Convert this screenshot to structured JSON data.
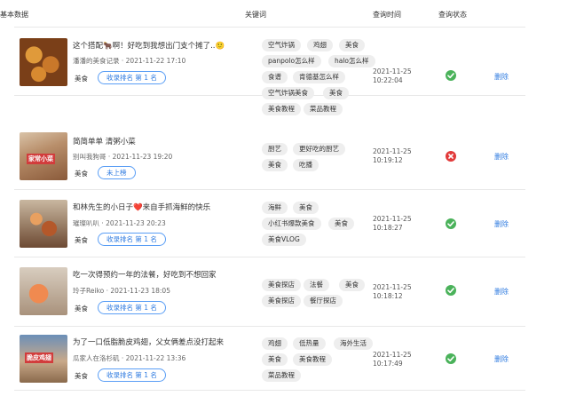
{
  "header": {
    "basic": "基本数据",
    "keywords": "关键词",
    "query_time": "查询时间",
    "query_status": "查询状态"
  },
  "rows": [
    {
      "title": "这个搭配🐂啊！好吃到我想出门支个摊了..🙂",
      "author_date": "潘潘的美食记录 · 2021-11-22 17:10",
      "category": "美食",
      "rank_label": "收录排名 第 1 名",
      "keywords": [
        "空气炸锅",
        "鸡翅",
        "美食",
        "panpolo怎么样",
        "halo怎么样",
        "食谱",
        "肯德基怎么样",
        "空气炸锅美食",
        "美食",
        "美食教程",
        "菜品教程"
      ],
      "time_date": "2021-11-25",
      "time_clock": "10:22:04",
      "status": "success",
      "delete_label": "删除"
    },
    {
      "title": "简简单单 清粥小菜",
      "author_date": "别叫我狗哥 · 2021-11-23 19:20",
      "category": "美食",
      "rank_label": "未上榜",
      "keywords": [
        "厨艺",
        "更好吃的厨艺",
        "美食",
        "吃播"
      ],
      "time_date": "2021-11-25",
      "time_clock": "10:19:12",
      "status": "failed",
      "delete_label": "删除"
    },
    {
      "title": "和林先生的小日子❤️来自手抓海鲜的快乐",
      "author_date": "璀璨叭叭 · 2021-11-23 20:23",
      "category": "美食",
      "rank_label": "收录排名 第 1 名",
      "keywords": [
        "海鲜",
        "美食",
        "小红书爆款美食",
        "美食",
        "美食VLOG"
      ],
      "time_date": "2021-11-25",
      "time_clock": "10:18:27",
      "status": "success",
      "delete_label": "删除"
    },
    {
      "title": "吃一次得预约一年的法餐，好吃到不想回家",
      "author_date": "玲子Reiko · 2021-11-23 18:05",
      "category": "美食",
      "rank_label": "收录排名 第 1 名",
      "keywords": [
        "美食探店",
        "法餐",
        "美食",
        "美食探店",
        "餐厅探店"
      ],
      "time_date": "2021-11-25",
      "time_clock": "10:18:12",
      "status": "success",
      "delete_label": "删除"
    },
    {
      "title": "为了一口低脂脆皮鸡翅，父女俩差点没打起来",
      "author_date": "瓜家人在洛杉矶 · 2021-11-22 13:36",
      "category": "美食",
      "rank_label": "收录排名 第 1 名",
      "keywords": [
        "鸡翅",
        "低热量",
        "海外生活",
        "美食",
        "美食教程",
        "菜品教程"
      ],
      "time_date": "2021-11-25",
      "time_clock": "10:17:49",
      "status": "success",
      "delete_label": "删除"
    }
  ],
  "thumb_text_2": "家常小菜",
  "thumb_text_5": "脆皮鸡翅"
}
